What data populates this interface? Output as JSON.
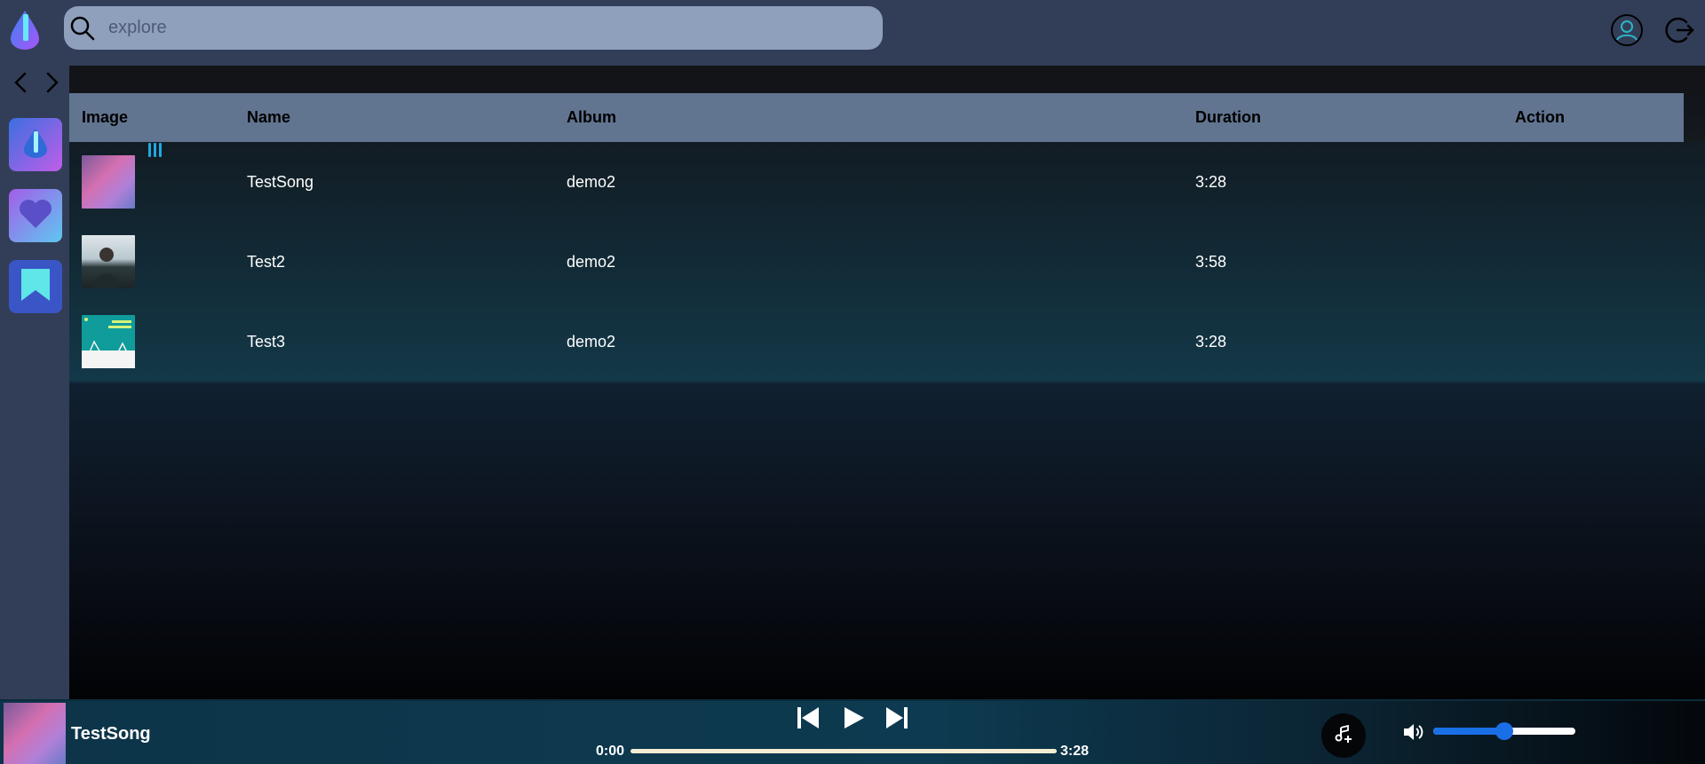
{
  "search": {
    "placeholder": "explore"
  },
  "table": {
    "headers": [
      "Image",
      "Name",
      "Album",
      "Duration",
      "Action"
    ],
    "rows": [
      {
        "name": "TestSong",
        "album": "demo2",
        "duration": "3:28",
        "playing": true
      },
      {
        "name": "Test2",
        "album": "demo2",
        "duration": "3:58",
        "playing": false
      },
      {
        "name": "Test3",
        "album": "demo2",
        "duration": "3:28",
        "playing": false
      }
    ]
  },
  "player": {
    "title": "TestSong",
    "current_time": "0:00",
    "total_time": "3:28",
    "progress": 0,
    "volume": 0.5
  },
  "icons": {
    "logo": "music-logo-icon",
    "search": "search-icon",
    "profile": "user-profile-icon",
    "logout": "logout-icon",
    "back": "chevron-left-icon",
    "forward": "chevron-right-icon",
    "home": "home-logo-icon",
    "liked": "heart-icon",
    "saved": "bookmark-icon",
    "prev": "skip-previous-icon",
    "play": "play-icon",
    "next": "skip-next-icon",
    "queue": "music-queue-icon",
    "volume": "volume-icon"
  },
  "colors": {
    "accent": "#1a6fe6",
    "playing_indicator": "#1ea9e0",
    "header_bg": "#627590",
    "search_bg": "#8fa0bd"
  }
}
